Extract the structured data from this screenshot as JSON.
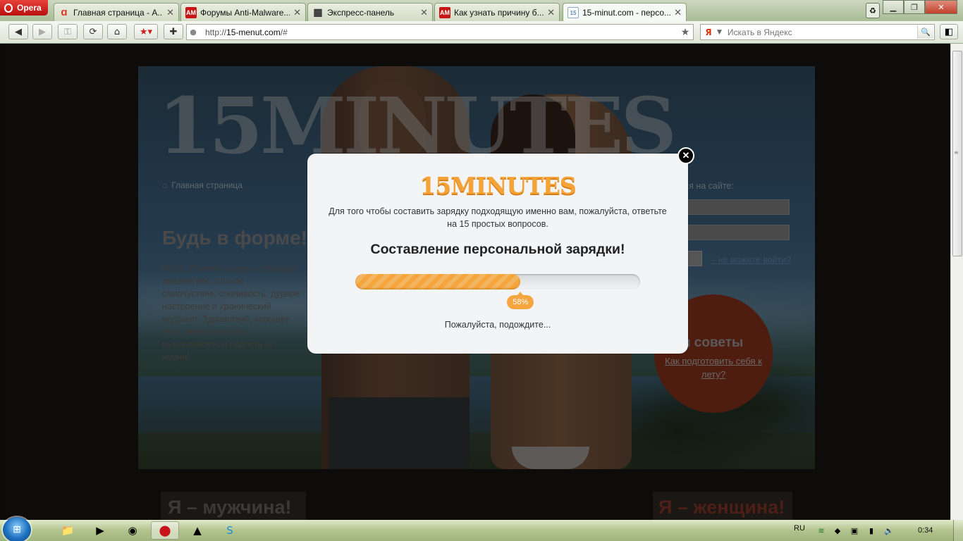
{
  "browser": {
    "menu_label": "Opera",
    "tabs": [
      {
        "title": "Главная страница - А...",
        "icon": "avira-icon",
        "active": false
      },
      {
        "title": "Форумы Anti-Malware...",
        "icon": "am-icon",
        "active": false
      },
      {
        "title": "Экспресс-панель",
        "icon": "speed-dial-icon",
        "active": false
      },
      {
        "title": "Как узнать причину б...",
        "icon": "am-icon",
        "active": false
      },
      {
        "title": "15-minut.com - персо...",
        "icon": "site-icon",
        "active": true
      }
    ],
    "address": {
      "prefix": "http://",
      "host": "15-menut.com",
      "path": "/#"
    },
    "search": {
      "engine_icon": "yandex-icon",
      "placeholder": "Искать в Яндекс"
    }
  },
  "page": {
    "big_logo": "15MINUTES",
    "breadcrumb": "Главная страница",
    "fit_title": "Будь в форме!",
    "fit_text": "Всего 15 минут в день и прощай лишний вес, плохое самочуствие, сонливость, дурное настроение и хронический недосып. Здравствуй, хорошее тело, много энергии, выносливость и радость от жизни!",
    "login_title": "ация на сайте:",
    "forgot_link": "– не можете войти?",
    "tips_title": "ши советы",
    "tips_link": "Как подготовить себя к лету?",
    "choice_man": "Я – мужчина!",
    "choice_woman": "Я – женщина!"
  },
  "modal": {
    "logo": "15MINUTES",
    "description": "Для того чтобы составить зарядку подходящую именно вам, пожалуйста, ответьте на 15 простых вопросов.",
    "heading": "Составление персональной зарядки!",
    "progress_percent": 58,
    "progress_label": "58%",
    "wait_text": "Пожалуйста, подождите..."
  },
  "taskbar": {
    "language": "RU",
    "clock": "0:34"
  },
  "colors": {
    "accent_orange": "#f5a236",
    "opera_red": "#c8141a"
  }
}
